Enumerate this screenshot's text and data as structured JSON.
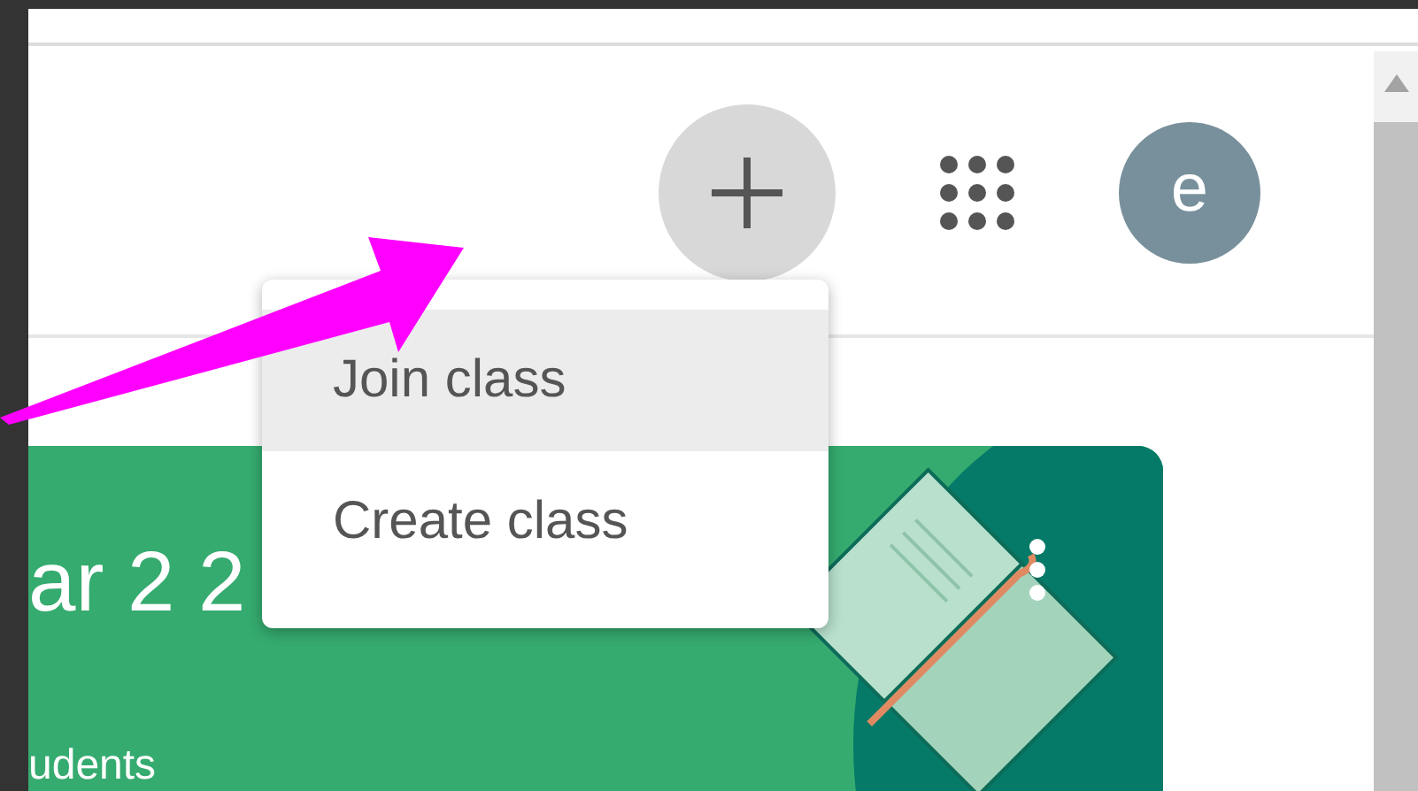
{
  "header": {
    "avatar_letter": "e"
  },
  "menu": {
    "items": [
      {
        "label": "Join class",
        "selected": true
      },
      {
        "label": "Create class",
        "selected": false
      }
    ]
  },
  "class_card": {
    "title": "ar 2 2",
    "subtitle": "udents"
  }
}
